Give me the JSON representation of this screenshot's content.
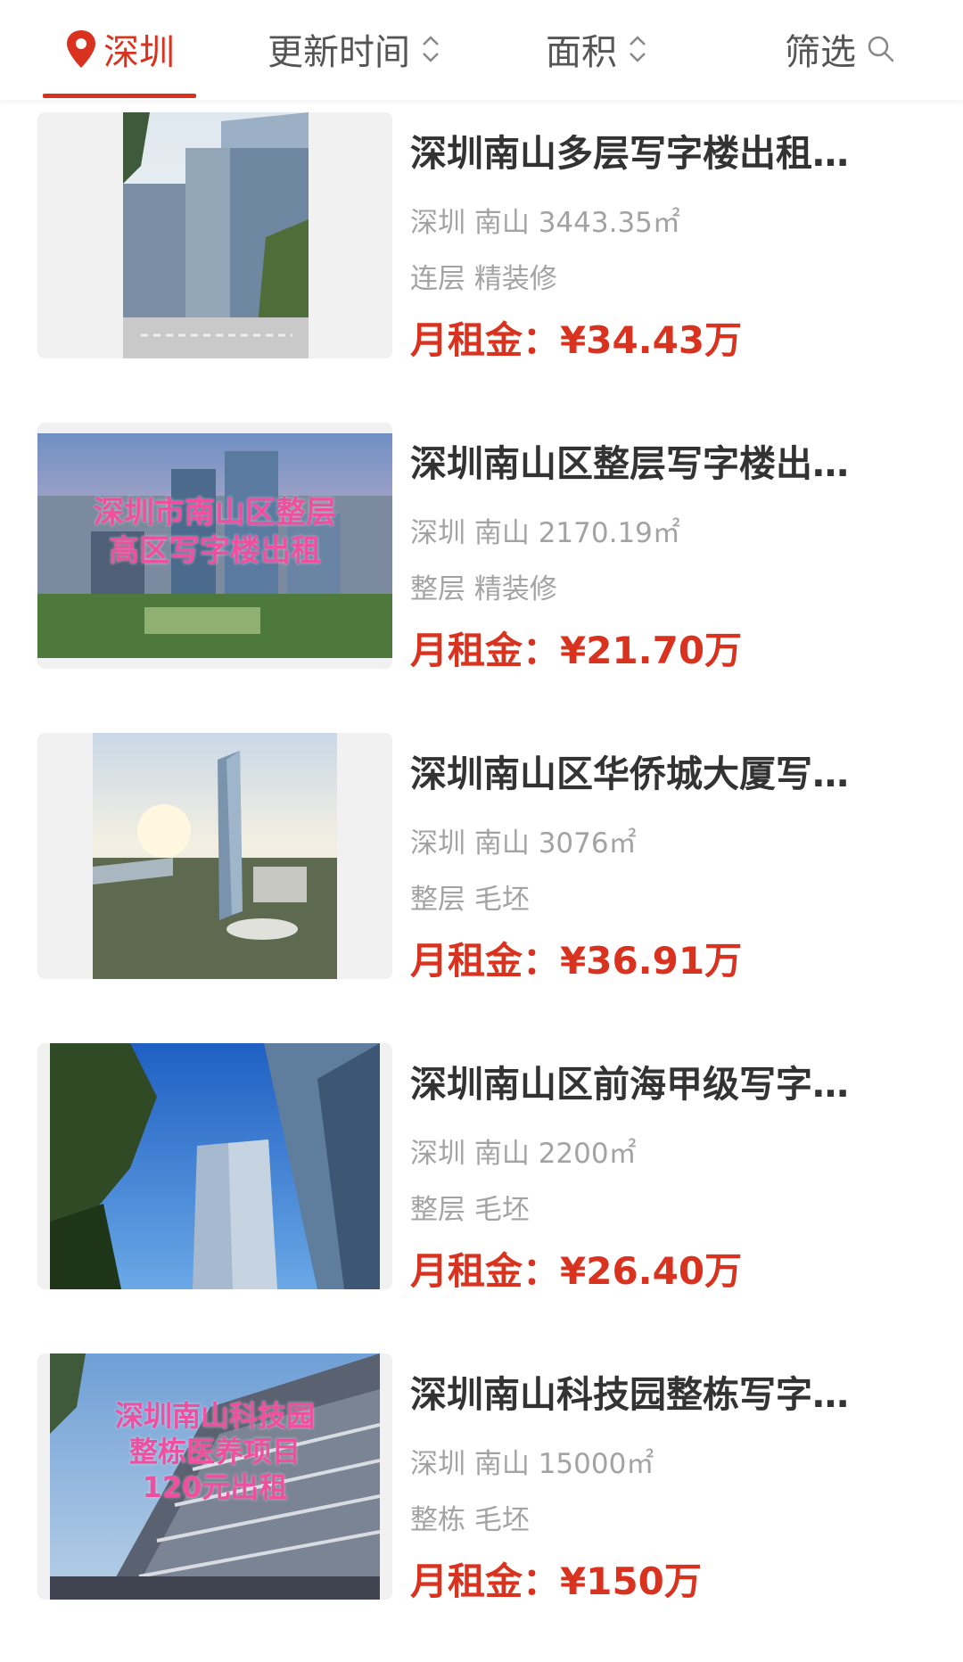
{
  "tabs": {
    "city": "深圳",
    "sort_time": "更新时间",
    "sort_area": "面积",
    "filter": "筛选"
  },
  "price_label": "月租金：",
  "accent_color": "#d9321f",
  "listings": [
    {
      "title": "深圳南山多层写字楼出租…",
      "location": "深圳 南山 3443.35㎡",
      "tags": "连层 精装修",
      "price": "¥34.43万",
      "image_overlay": []
    },
    {
      "title": "深圳南山区整层写字楼出…",
      "location": "深圳 南山 2170.19㎡",
      "tags": "整层 精装修",
      "price": "¥21.70万",
      "image_overlay": [
        "深圳市南山区整层",
        "高区写字楼出租"
      ]
    },
    {
      "title": "深圳南山区华侨城大厦写…",
      "location": "深圳 南山 3076㎡",
      "tags": "整层 毛坯",
      "price": "¥36.91万",
      "image_overlay": []
    },
    {
      "title": "深圳南山区前海甲级写字…",
      "location": "深圳 南山 2200㎡",
      "tags": "整层 毛坯",
      "price": "¥26.40万",
      "image_overlay": []
    },
    {
      "title": "深圳南山科技园整栋写字…",
      "location": "深圳 南山 15000㎡",
      "tags": "整栋 毛坯",
      "price": "¥150万",
      "image_overlay": [
        "深圳南山科技园",
        "整栋医养项目",
        "120元出租"
      ]
    }
  ]
}
